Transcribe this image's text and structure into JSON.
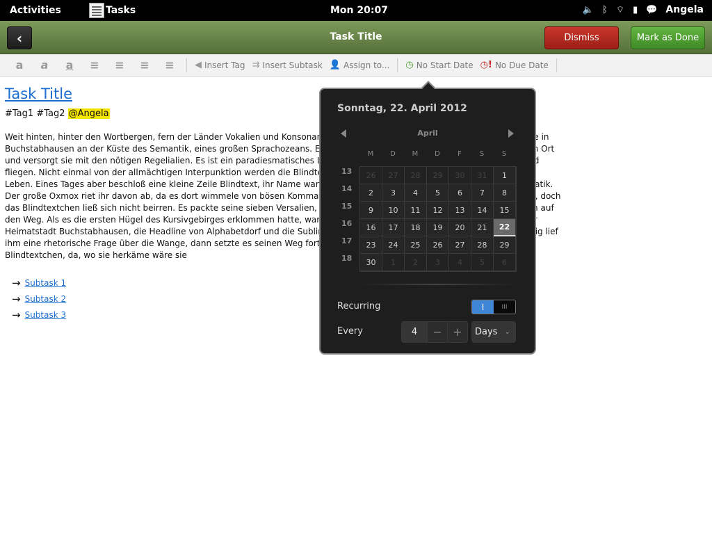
{
  "topbar": {
    "activities": "Activities",
    "app_name": "Tasks",
    "clock": "Mon 20:07",
    "user": "Angela"
  },
  "header": {
    "title": "Task Title",
    "dismiss_label": "Dismiss",
    "done_label": "Mark as Done"
  },
  "toolbar": {
    "insert_tag": "Insert Tag",
    "insert_subtask": "Insert Subtask",
    "assign_to": "Assign to...",
    "no_start_date": "No Start Date",
    "no_due_date": "No Due Date"
  },
  "editor": {
    "title": "Task Title",
    "tags": "#Tag1 #Tag2",
    "mention": "@Angela",
    "body": "Weit hinten, hinter den Wortbergen, fern der Länder Vokalien und Konsonantien leben die Blindtexte. Abgeschieden wohnen sie in Buchstabhausen an der Küste des Semantik, eines großen Sprachozeans. Ein kleines Bächlein namens Duden fließt durch ihren Ort und versorgt sie mit den nötigen Regelialien. Es ist ein paradiesmatisches Land, in dem einem gebratene Satzteile in den Mund fliegen. Nicht einmal von der allmächtigen Interpunktion werden die Blindtexte beherrscht – ein geradezu unorthographisches Leben. Eines Tages aber beschloß eine kleine Zeile Blindtext, ihr Name war Lorem Ipsum, hinaus zu gehen in die weite Grammatik. Der große Oxmox riet ihr davon ab, da es dort wimmele von bösen Kommata, wilden Fragezeichen und hinterhältigen Semikoli, doch das Blindtextchen ließ sich nicht beirren. Es packte seine sieben Versalien, schob sich sein Initial in den Gürtel und machte sich auf den Weg. Als es die ersten Hügel des Kursivgebirges erklommen hatte, warf es einen letzten Blick zurück auf die Skyline seiner Heimatstadt Buchstabhausen, die Headline von Alphabetdorf und die Subline seiner eigenen Straße, der Zeilengasse. Wehmütig lief ihm eine rhetorische Frage über die Wange, dann setzte es seinen Weg fort. Unterwegs traf es eine Copy. Die Copy warnte das Blindtextchen, da, wo sie herkäme wäre sie",
    "subtasks": [
      "Subtask 1",
      "Subtask 2",
      "Subtask 3"
    ]
  },
  "popover": {
    "date_header": "Sonntag, 22. April 2012",
    "month": "April",
    "day_headers": [
      "M",
      "D",
      "M",
      "D",
      "F",
      "S",
      "S"
    ],
    "week_numbers": [
      "13",
      "14",
      "15",
      "16",
      "17",
      "18"
    ],
    "days": [
      [
        "26",
        "27",
        "28",
        "29",
        "30",
        "31",
        "1"
      ],
      [
        "2",
        "3",
        "4",
        "5",
        "6",
        "7",
        "8"
      ],
      [
        "9",
        "10",
        "11",
        "12",
        "13",
        "14",
        "15"
      ],
      [
        "16",
        "17",
        "18",
        "19",
        "20",
        "21",
        "22"
      ],
      [
        "23",
        "24",
        "25",
        "26",
        "27",
        "28",
        "29"
      ],
      [
        "30",
        "1",
        "2",
        "3",
        "4",
        "5",
        "6"
      ]
    ],
    "selected_day": "22",
    "recurring_label": "Recurring",
    "recurring_on": true,
    "every_label": "Every",
    "every_value": "4",
    "every_unit": "Days"
  },
  "colors": {
    "header_green": "#6a8648",
    "dismiss_red": "#b52a21",
    "done_green": "#4fa033",
    "link_blue": "#1a6fd1",
    "mention_yellow": "#f5e600",
    "toggle_blue": "#3f86d6"
  }
}
